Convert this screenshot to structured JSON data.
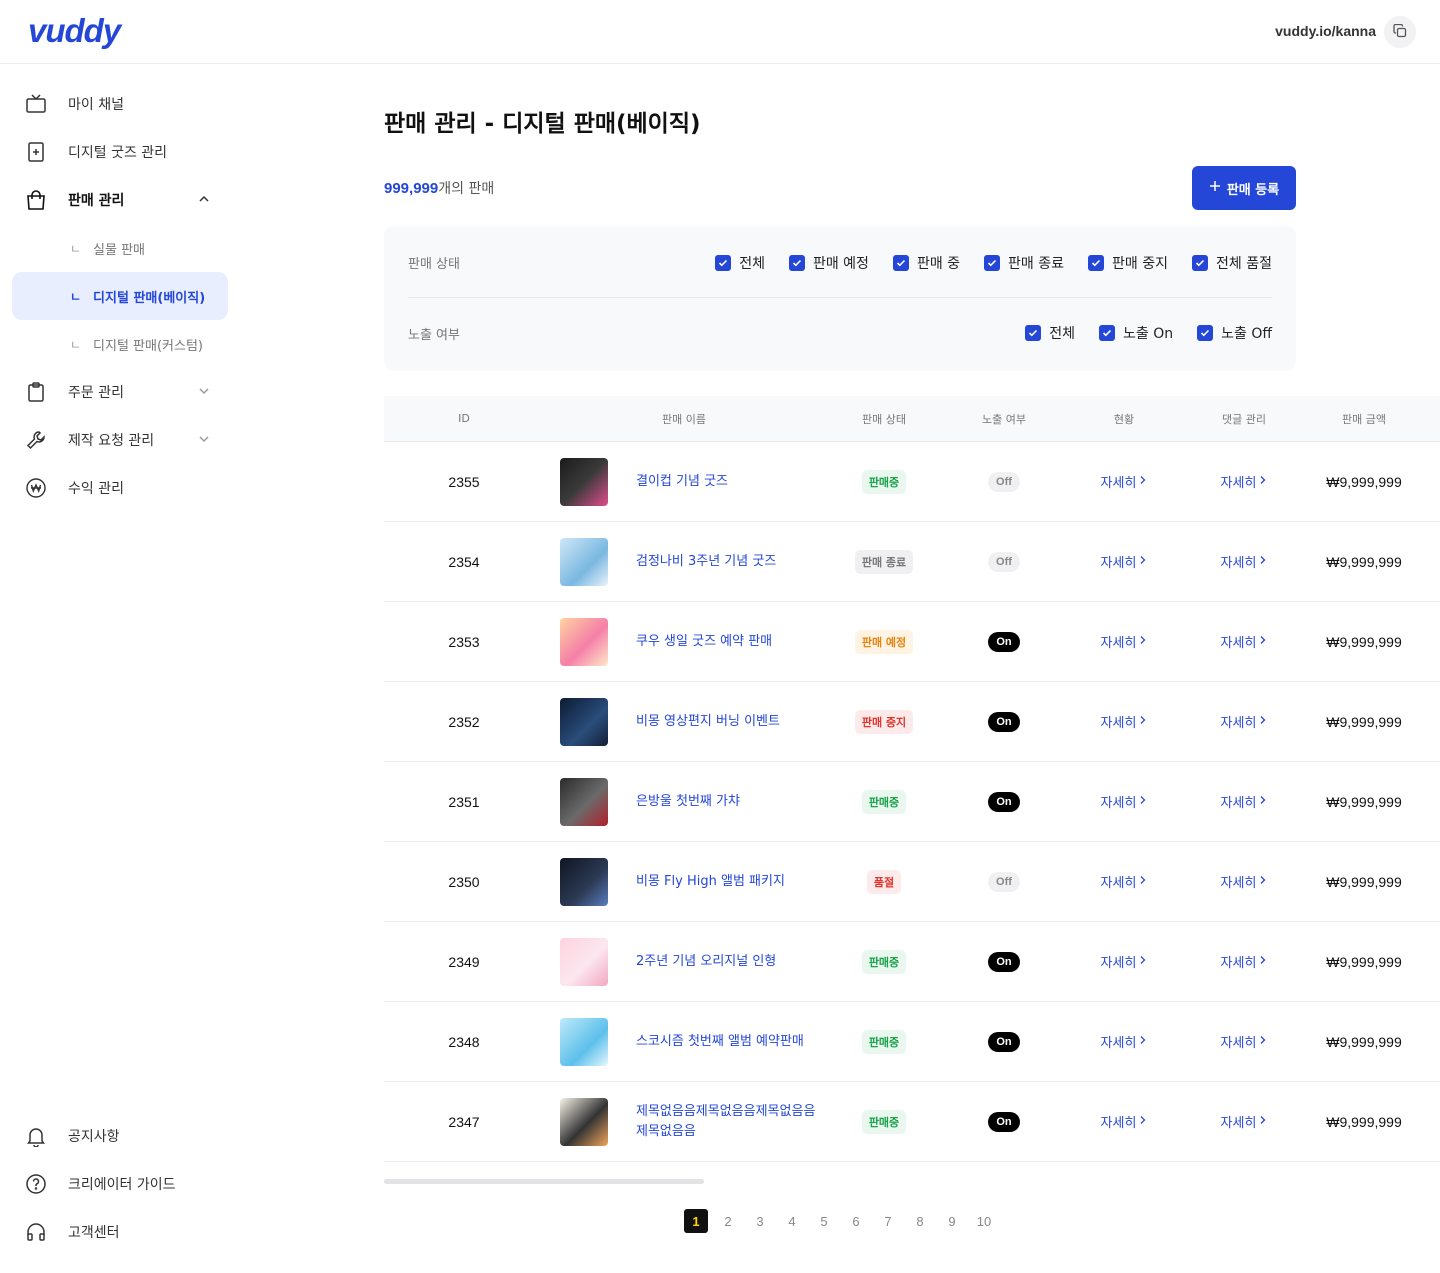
{
  "header": {
    "logo": "vuddy",
    "channel_url": "vuddy.io/kanna"
  },
  "sidebar": {
    "items": [
      {
        "label": "마이 채널",
        "icon": "tv-icon"
      },
      {
        "label": "디지털 굿즈 관리",
        "icon": "digital-goods-icon"
      },
      {
        "label": "판매 관리",
        "icon": "shopping-bag-icon"
      },
      {
        "label": "주문 관리",
        "icon": "clipboard-icon"
      },
      {
        "label": "제작 요청 관리",
        "icon": "wrench-icon"
      },
      {
        "label": "수익 관리",
        "icon": "won-icon"
      }
    ],
    "sub_items": [
      {
        "mark": "ㄴ",
        "label": "실물 판매"
      },
      {
        "mark": "ㄴ",
        "label": "디지털 판매(베이직)"
      },
      {
        "mark": "ㄴ",
        "label": "디지털 판매(커스텀)"
      }
    ],
    "bottom_items": [
      {
        "label": "공지사항",
        "icon": "bell-icon"
      },
      {
        "label": "크리에이터 가이드",
        "icon": "help-circle-icon"
      },
      {
        "label": "고객센터",
        "icon": "headset-icon"
      }
    ]
  },
  "main": {
    "title": "판매 관리 - 디지털 판매(베이직)",
    "count_number": "999,999",
    "count_suffix": "개의 판매",
    "register_button": "판매 등록"
  },
  "filters": {
    "status_label": "판매 상태",
    "status_options": [
      "전체",
      "판매 예정",
      "판매 중",
      "판매 종료",
      "판매 중지",
      "전체 품절"
    ],
    "exposure_label": "노출 여부",
    "exposure_options": [
      "전체",
      "노출 On",
      "노출 Off"
    ]
  },
  "table": {
    "columns": [
      "ID",
      "판매 이름",
      "판매 상태",
      "노출 여부",
      "현황",
      "댓글 관리",
      "판매 금액"
    ],
    "rows": [
      {
        "id": "2355",
        "name": "결이컵 기념 굿즈",
        "status": "판매중",
        "status_color": "green",
        "exposure": "Off",
        "view": "자세히",
        "comment": "자세히",
        "price": "₩9,999,999"
      },
      {
        "id": "2354",
        "name": "검정나비 3주년 기념 굿즈",
        "status": "판매 종료",
        "status_color": "gray",
        "exposure": "Off",
        "view": "자세히",
        "comment": "자세히",
        "price": "₩9,999,999"
      },
      {
        "id": "2353",
        "name": "쿠우 생일 굿즈 예약 판매",
        "status": "판매 예정",
        "status_color": "orange",
        "exposure": "On",
        "view": "자세히",
        "comment": "자세히",
        "price": "₩9,999,999"
      },
      {
        "id": "2352",
        "name": "비몽 영상편지 버닝 이벤트",
        "status": "판매 중지",
        "status_color": "red",
        "exposure": "On",
        "view": "자세히",
        "comment": "자세히",
        "price": "₩9,999,999"
      },
      {
        "id": "2351",
        "name": "은방울 첫번째 가챠",
        "status": "판매중",
        "status_color": "green",
        "exposure": "On",
        "view": "자세히",
        "comment": "자세히",
        "price": "₩9,999,999"
      },
      {
        "id": "2350",
        "name": "비몽 Fly High 앨범 패키지",
        "status": "품절",
        "status_color": "red",
        "exposure": "Off",
        "view": "자세히",
        "comment": "자세히",
        "price": "₩9,999,999"
      },
      {
        "id": "2349",
        "name": "2주년 기념 오리지널 인형",
        "status": "판매중",
        "status_color": "green",
        "exposure": "On",
        "view": "자세히",
        "comment": "자세히",
        "price": "₩9,999,999"
      },
      {
        "id": "2348",
        "name": "스코시즘 첫번째 앨범 예약판매",
        "status": "판매중",
        "status_color": "green",
        "exposure": "On",
        "view": "자세히",
        "comment": "자세히",
        "price": "₩9,999,999"
      },
      {
        "id": "2347",
        "name": "제목없음음제목없음음제목없음음제목없음음",
        "status": "판매중",
        "status_color": "green",
        "exposure": "On",
        "view": "자세히",
        "comment": "자세히",
        "price": "₩9,999,999"
      }
    ]
  },
  "pagination": {
    "pages": [
      "1",
      "2",
      "3",
      "4",
      "5",
      "6",
      "7",
      "8",
      "9",
      "10"
    ],
    "current": "1"
  },
  "colors": {
    "accent": "#2447d8",
    "active_bg": "#e8eefe",
    "green": "#17a34a",
    "orange": "#e6840f",
    "red": "#e0342b"
  }
}
